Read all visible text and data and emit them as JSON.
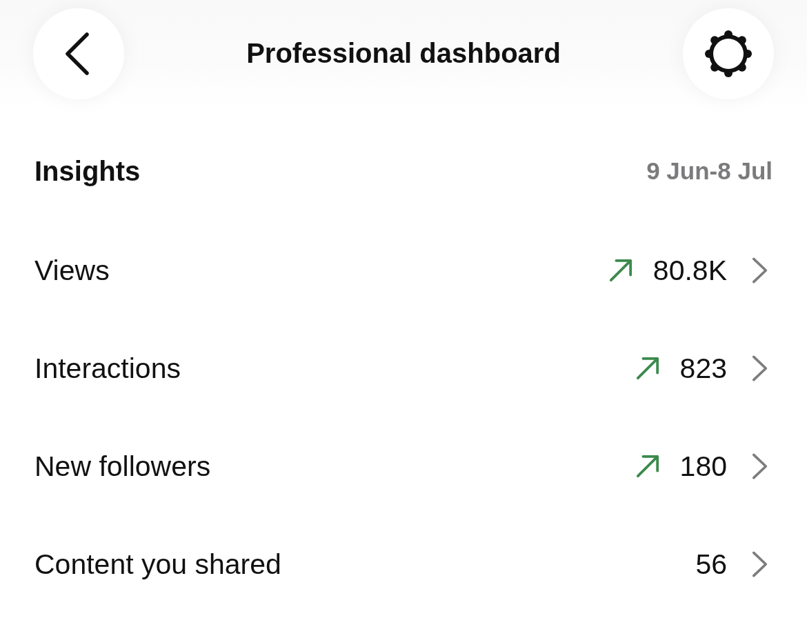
{
  "header": {
    "title": "Professional dashboard"
  },
  "insights": {
    "title": "Insights",
    "date_range": "9 Jun-8 Jul"
  },
  "metrics": [
    {
      "label": "Views",
      "value": "80.8K",
      "trending_up": true
    },
    {
      "label": "Interactions",
      "value": "823",
      "trending_up": true
    },
    {
      "label": "New followers",
      "value": "180",
      "trending_up": true
    },
    {
      "label": "Content you shared",
      "value": "56",
      "trending_up": false
    }
  ]
}
